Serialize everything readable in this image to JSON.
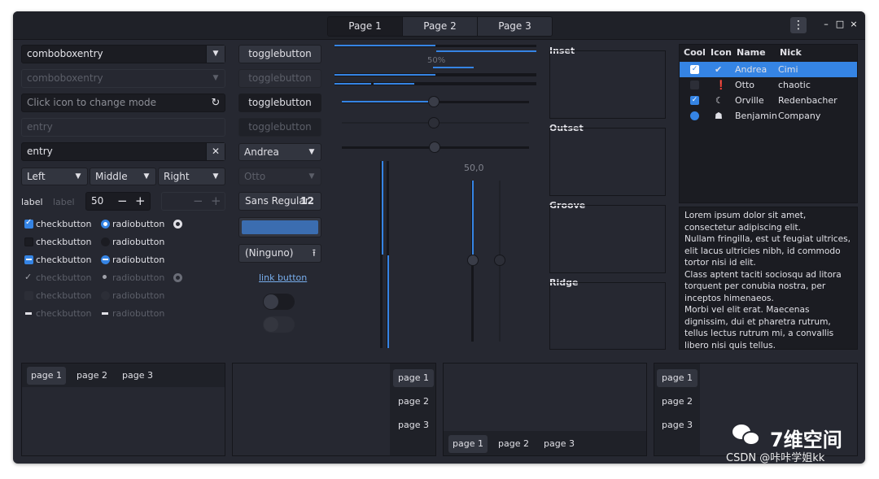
{
  "header": {
    "tabs": [
      "Page 1",
      "Page 2",
      "Page 3"
    ],
    "menu_icon": "kebab-menu-icon",
    "window_buttons": {
      "minimize": "–",
      "maximize": "□",
      "close": "×"
    }
  },
  "left": {
    "combo1": "comboboxentry",
    "combo2": "comboboxentry",
    "entry_placeholder": "Click icon to change mode",
    "entry_disabled": "entry",
    "entry_value": "entry",
    "selector": [
      "Left",
      "Middle",
      "Right"
    ],
    "label1": "label",
    "label2": "label",
    "spin_value": "50",
    "spin_minus": "−",
    "spin_plus": "+",
    "checks": [
      {
        "check": "checkbutton",
        "radio": "radiobutton"
      },
      {
        "check": "checkbutton",
        "radio": "radiobutton"
      },
      {
        "check": "checkbutton",
        "radio": "radiobutton"
      },
      {
        "check": "checkbutton",
        "radio": "radiobutton"
      },
      {
        "check": "checkbutton",
        "radio": "radiobutton"
      },
      {
        "check": "checkbutton",
        "radio": "radiobutton"
      }
    ]
  },
  "middle": {
    "toggle": [
      "togglebutton",
      "togglebutton",
      "togglebutton",
      "togglebutton"
    ],
    "combo_andrea": "Andrea",
    "combo_otto": "Otto",
    "font_name": "Sans Regular",
    "font_size": "12",
    "color_accent": "#3b6db0",
    "file_button": "(Ninguno)",
    "link_button": "link button"
  },
  "progress": {
    "percent_label": "50%",
    "fraction": 0.5,
    "scale_value": "50,0"
  },
  "frames": [
    "Inset",
    "Outset",
    "Groove",
    "Ridge"
  ],
  "tree": {
    "columns": [
      "Cool",
      "Icon",
      "Name",
      "Nick"
    ],
    "rows": [
      {
        "cool": true,
        "icon": "check-circle-icon",
        "name": "Andrea",
        "nick": "Cimi",
        "selected": true
      },
      {
        "cool": false,
        "icon": "alert-circle-icon",
        "name": "Otto",
        "nick": "chaotic",
        "selected": false
      },
      {
        "cool": true,
        "icon": "moon-icon",
        "name": "Orville",
        "nick": "Redenbacher",
        "selected": false
      },
      {
        "cool": "radio",
        "icon": "robot-icon",
        "name": "Benjamin",
        "nick": "Company",
        "selected": false
      }
    ]
  },
  "textview": "Lorem ipsum dolor sit amet, consectetur adipiscing elit.\nNullam fringilla, est ut feugiat ultrices, elit lacus ultricies nibh, id commodo tortor nisi id elit.\nClass aptent taciti sociosqu ad litora torquent per conubia nostra, per inceptos himenaeos.\nMorbi vel elit erat. Maecenas dignissim, dui et pharetra rutrum, tellus lectus rutrum mi, a convallis libero nisi quis tellus.",
  "notebooks": [
    {
      "tabs": [
        "page 1",
        "page 2",
        "page 3"
      ]
    },
    {
      "tabs": [
        "page 1",
        "page 2",
        "page 3"
      ]
    },
    {
      "tabs": [
        "page 1",
        "page 2",
        "page 3"
      ]
    },
    {
      "tabs": [
        "page 1",
        "page 2",
        "page 3"
      ]
    }
  ],
  "watermark": {
    "title": "7维空间",
    "caption": "CSDN @咔咔学姐kk"
  }
}
